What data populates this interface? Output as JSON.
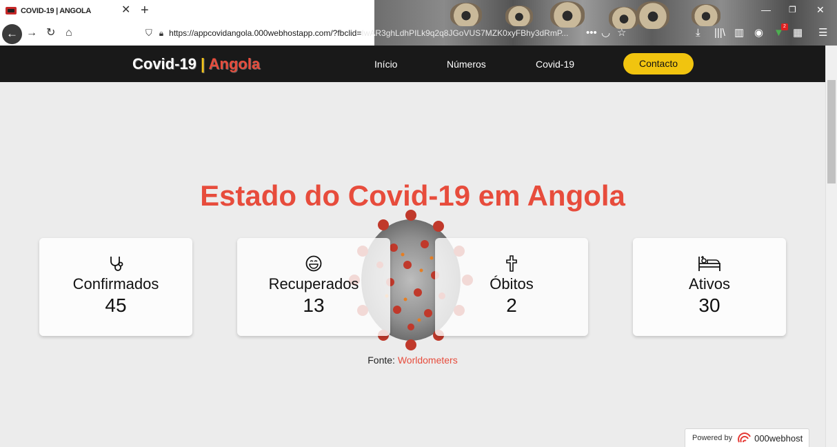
{
  "browser": {
    "tab_title": "COVID-19 | ANGOLA",
    "url_prefix": "https://appcovidangola.000webhostapp.com/?fbclid=",
    "url_rest": "IwAR3ghLdhPILk9q2q8JGoVUS7MZK0xyFBhy3dRmP...",
    "icons": {
      "back": "back-arrow-icon",
      "forward": "forward-arrow-icon",
      "reload": "reload-icon",
      "home": "home-icon",
      "shield": "shield-icon",
      "lock": "lock-icon",
      "pocket": "pocket-icon",
      "bookmark": "star-icon",
      "download": "download-icon",
      "library": "library-icon",
      "sidebar": "sidebar-icon",
      "account": "account-icon",
      "extension": "extension-icon",
      "menu": "hamburger-menu-icon"
    },
    "extension_badge": "2"
  },
  "site": {
    "brand_main": "Covid-19",
    "brand_sep": "|",
    "brand_accent": "Angola",
    "nav": {
      "home": "Início",
      "numbers": "Números",
      "covid": "Covid-19",
      "contact": "Contacto"
    },
    "colors": {
      "accent": "#e74c3c",
      "button": "#f1c40f",
      "header_bg": "#191919"
    }
  },
  "main": {
    "title": "Estado do Covid-19 em Angola",
    "cards": [
      {
        "label": "Confirmados",
        "value": "45",
        "icon": "stethoscope-icon"
      },
      {
        "label": "Recuperados",
        "value": "13",
        "icon": "smiley-icon"
      },
      {
        "label": "Óbitos",
        "value": "2",
        "icon": "cross-icon"
      },
      {
        "label": "Ativos",
        "value": "30",
        "icon": "hospital-bed-icon"
      }
    ],
    "source_label": "Fonte:",
    "source_link": "Worldometers"
  },
  "footer": {
    "powered_label": "Powered by",
    "powered_brand": "000webhost"
  }
}
